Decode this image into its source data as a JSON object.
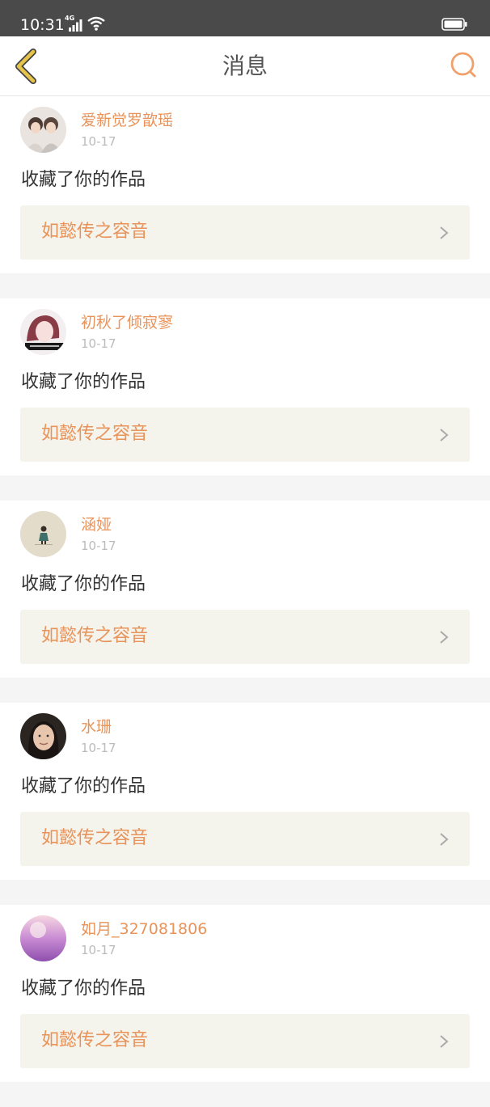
{
  "status_bar": {
    "time": "10:31",
    "network": "4G",
    "icons": [
      "signal-icon",
      "wifi-icon",
      "battery-icon"
    ]
  },
  "nav": {
    "title": "消息",
    "back_icon": "chevron-left-icon",
    "search_icon": "search-icon"
  },
  "colors": {
    "accent": "#e8935a",
    "back_yellow": "#e6c44a",
    "card_link_bg": "#f4f3ec",
    "status_bar": "#4a4a4a"
  },
  "notifications": [
    {
      "username": "爱新觉罗歆瑶",
      "date": "10-17",
      "message": "收藏了你的作品",
      "work_title": "如懿传之容音"
    },
    {
      "username": "初秋了倾寂寥",
      "date": "10-17",
      "message": "收藏了你的作品",
      "work_title": "如懿传之容音"
    },
    {
      "username": "涵娅",
      "date": "10-17",
      "message": "收藏了你的作品",
      "work_title": "如懿传之容音"
    },
    {
      "username": "水珊",
      "date": "10-17",
      "message": "收藏了你的作品",
      "work_title": "如懿传之容音"
    },
    {
      "username": "如月_327081806",
      "date": "10-17",
      "message": "收藏了你的作品",
      "work_title": "如懿传之容音"
    }
  ]
}
